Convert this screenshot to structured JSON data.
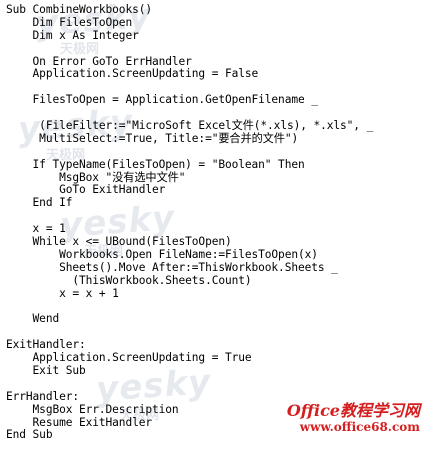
{
  "code_lines": [
    "Sub CombineWorkbooks()",
    "    Dim FilesToOpen",
    "    Dim x As Integer",
    "",
    "    On Error GoTo ErrHandler",
    "    Application.ScreenUpdating = False",
    "",
    "    FilesToOpen = Application.GetOpenFilename _",
    "",
    "     (FileFilter:=\"MicroSoft Excel文件(*.xls), *.xls\", _",
    "     MultiSelect:=True, Title:=\"要合并的文件\")",
    "",
    "    If TypeName(FilesToOpen) = \"Boolean\" Then",
    "        MsgBox \"没有选中文件\"",
    "        GoTo ExitHandler",
    "    End If",
    "",
    "    x = 1",
    "    While x <= UBound(FilesToOpen)",
    "        Workbooks.Open FileName:=FilesToOpen(x)",
    "        Sheets().Move After:=ThisWorkbook.Sheets _",
    "          (ThisWorkbook.Sheets.Count)",
    "        x = x + 1",
    "",
    "    Wend",
    "",
    "ExitHandler:",
    "    Application.ScreenUpdating = True",
    "    Exit Sub",
    "",
    "ErrHandler:",
    "    MsgBox Err.Description",
    "    Resume ExitHandler",
    "End Sub"
  ],
  "watermark": {
    "text": "yesky",
    "sub_text": "天极网"
  },
  "brand": {
    "name": "Office教程学习网",
    "url": "www.office68.com"
  }
}
